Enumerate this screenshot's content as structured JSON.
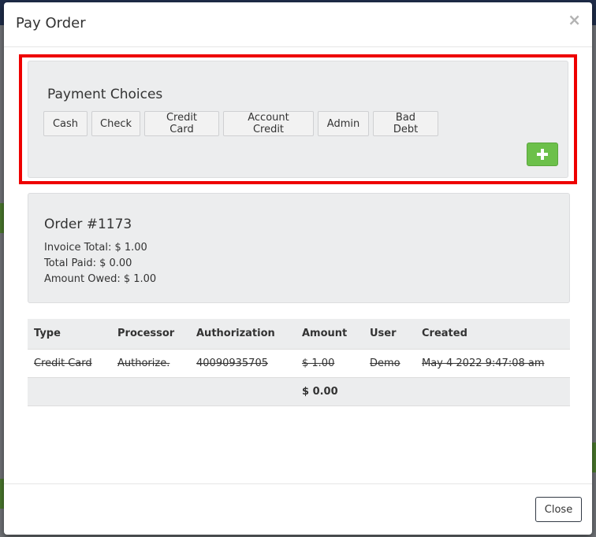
{
  "modal": {
    "title": "Pay Order",
    "close_symbol": "×"
  },
  "payment_choices": {
    "title": "Payment Choices",
    "buttons": [
      "Cash",
      "Check",
      "Credit Card",
      "Account Credit",
      "Admin",
      "Bad Debt"
    ],
    "add_icon": "plus-icon",
    "add_color": "#6cc04a"
  },
  "order": {
    "title": "Order #1173",
    "invoice_total": "Invoice Total: $ 1.00",
    "total_paid": "Total Paid: $ 0.00",
    "amount_owed": "Amount Owed: $ 1.00"
  },
  "payments_table": {
    "headers": [
      "Type",
      "Processor",
      "Authorization",
      "Amount",
      "User",
      "Created"
    ],
    "rows": [
      [
        "Credit Card",
        "Authorize.",
        "40090935705",
        "$ 1.00",
        "Demo",
        "May 4 2022 9:47:08 am"
      ]
    ],
    "total": "$ 0.00"
  },
  "footer": {
    "close_label": "Close"
  },
  "colors": {
    "highlight_border": "#ee0000",
    "background_overlay": "#6b6e72"
  }
}
